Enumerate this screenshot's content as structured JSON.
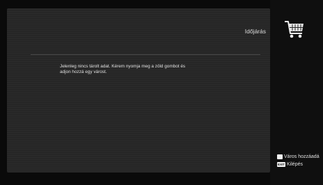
{
  "header": {
    "title": "Időjárás"
  },
  "main": {
    "message_line1": "Jelenleg nincs tárolt adat. Kérem nyomja meg a zöld gombot és",
    "message_line2": "adjon hozzá egy várost."
  },
  "side_icon": "shopping-cart-icon",
  "legend": {
    "add_city_label": "Város hozzáadá",
    "exit_key_label": "EXIT",
    "exit_label": "Kilépés"
  }
}
